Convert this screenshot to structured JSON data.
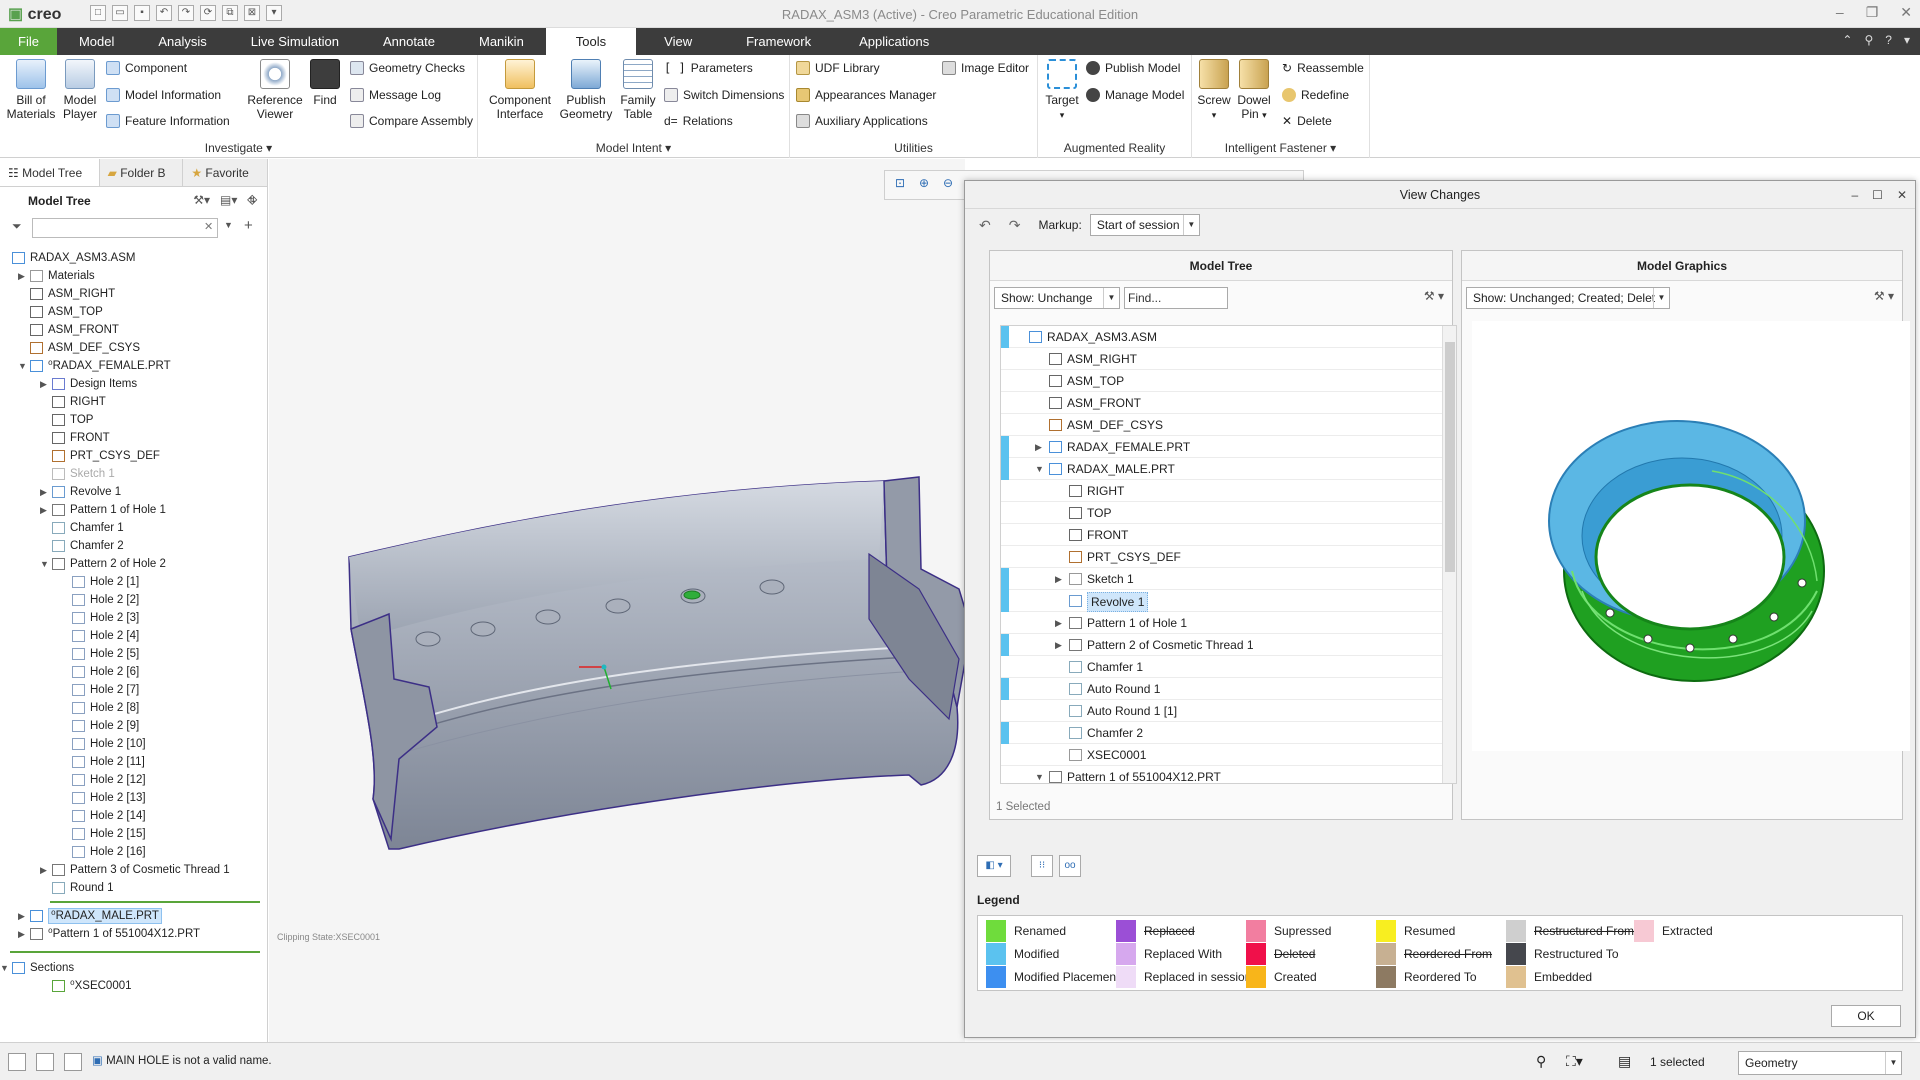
{
  "app": {
    "logo": "creo",
    "window_title": "RADAX_ASM3 (Active) - Creo Parametric Educational Edition"
  },
  "ribbon_tabs": [
    "File",
    "Model",
    "Analysis",
    "Live Simulation",
    "Annotate",
    "Manikin",
    "Tools",
    "View",
    "Framework",
    "Applications"
  ],
  "ribbon": {
    "investigate": {
      "label": "Investigate",
      "bill_of_materials": "Bill of Materials",
      "model_player": "Model Player",
      "component": "Component",
      "model_information": "Model Information",
      "feature_information": "Feature Information",
      "reference_viewer": "Reference Viewer",
      "find": "Find",
      "geometry_checks": "Geometry Checks",
      "message_log": "Message Log",
      "compare_assembly": "Compare Assembly"
    },
    "model_intent": {
      "label": "Model Intent",
      "component_interface": "Component Interface",
      "publish_geometry": "Publish Geometry",
      "family_table": "Family Table",
      "parameters": "Parameters",
      "switch_dimensions": "Switch Dimensions",
      "relations": "Relations"
    },
    "utilities": {
      "label": "Utilities",
      "udf_library": "UDF Library",
      "appearances_manager": "Appearances Manager",
      "auxiliary_applications": "Auxiliary Applications",
      "image_editor": "Image Editor"
    },
    "augmented_reality": {
      "label": "Augmented Reality",
      "target": "Target",
      "publish_model": "Publish Model",
      "manage_model": "Manage Model"
    },
    "intelligent_fastener": {
      "label": "Intelligent Fastener",
      "screw": "Screw",
      "dowel_pin": "Dowel Pin",
      "reassemble": "Reassemble",
      "redefine": "Redefine",
      "delete": "Delete"
    }
  },
  "left_panel": {
    "tabs": [
      "Model Tree",
      "Folder B",
      "Favorite"
    ],
    "header": "Model Tree",
    "tree": [
      {
        "label": "RADAX_ASM3.ASM",
        "level": 0,
        "exp": "",
        "icon": "#4a90d9"
      },
      {
        "label": "Materials",
        "level": 1,
        "exp": "▶",
        "icon": "#999"
      },
      {
        "label": "ASM_RIGHT",
        "level": 1,
        "exp": "",
        "icon": "#666"
      },
      {
        "label": "ASM_TOP",
        "level": 1,
        "exp": "",
        "icon": "#666"
      },
      {
        "label": "ASM_FRONT",
        "level": 1,
        "exp": "",
        "icon": "#666"
      },
      {
        "label": "ASM_DEF_CSYS",
        "level": 1,
        "exp": "",
        "icon": "#b07030"
      },
      {
        "label": "⁰RADAX_FEMALE.PRT",
        "level": 1,
        "exp": "▼",
        "icon": "#4a90d9"
      },
      {
        "label": "Design Items",
        "level": 2,
        "exp": "▶",
        "icon": "#6a7bd0"
      },
      {
        "label": "RIGHT",
        "level": 2,
        "exp": "",
        "icon": "#666"
      },
      {
        "label": "TOP",
        "level": 2,
        "exp": "",
        "icon": "#666"
      },
      {
        "label": "FRONT",
        "level": 2,
        "exp": "",
        "icon": "#666"
      },
      {
        "label": "PRT_CSYS_DEF",
        "level": 2,
        "exp": "",
        "icon": "#b07030"
      },
      {
        "label": "Sketch 1",
        "level": 2,
        "exp": "",
        "icon": "#bbb",
        "dim": true
      },
      {
        "label": "Revolve 1",
        "level": 2,
        "exp": "▶",
        "icon": "#6a9bd0"
      },
      {
        "label": "Pattern 1 of Hole 1",
        "level": 2,
        "exp": "▶",
        "icon": "#777"
      },
      {
        "label": "Chamfer 1",
        "level": 2,
        "exp": "",
        "icon": "#8ab"
      },
      {
        "label": "Chamfer 2",
        "level": 2,
        "exp": "",
        "icon": "#8ab"
      },
      {
        "label": "Pattern 2 of Hole 2",
        "level": 2,
        "exp": "▼",
        "icon": "#777"
      },
      {
        "label": "Hole 2 [1]",
        "level": 3,
        "exp": "",
        "icon": "#8aa0c0"
      },
      {
        "label": "Hole 2 [2]",
        "level": 3,
        "exp": "",
        "icon": "#8aa0c0"
      },
      {
        "label": "Hole 2 [3]",
        "level": 3,
        "exp": "",
        "icon": "#8aa0c0"
      },
      {
        "label": "Hole 2 [4]",
        "level": 3,
        "exp": "",
        "icon": "#8aa0c0"
      },
      {
        "label": "Hole 2 [5]",
        "level": 3,
        "exp": "",
        "icon": "#8aa0c0"
      },
      {
        "label": "Hole 2 [6]",
        "level": 3,
        "exp": "",
        "icon": "#8aa0c0"
      },
      {
        "label": "Hole 2 [7]",
        "level": 3,
        "exp": "",
        "icon": "#8aa0c0"
      },
      {
        "label": "Hole 2 [8]",
        "level": 3,
        "exp": "",
        "icon": "#8aa0c0"
      },
      {
        "label": "Hole 2 [9]",
        "level": 3,
        "exp": "",
        "icon": "#8aa0c0"
      },
      {
        "label": "Hole 2 [10]",
        "level": 3,
        "exp": "",
        "icon": "#8aa0c0"
      },
      {
        "label": "Hole 2 [11]",
        "level": 3,
        "exp": "",
        "icon": "#8aa0c0"
      },
      {
        "label": "Hole 2 [12]",
        "level": 3,
        "exp": "",
        "icon": "#8aa0c0"
      },
      {
        "label": "Hole 2 [13]",
        "level": 3,
        "exp": "",
        "icon": "#8aa0c0"
      },
      {
        "label": "Hole 2 [14]",
        "level": 3,
        "exp": "",
        "icon": "#8aa0c0"
      },
      {
        "label": "Hole 2 [15]",
        "level": 3,
        "exp": "",
        "icon": "#8aa0c0"
      },
      {
        "label": "Hole 2 [16]",
        "level": 3,
        "exp": "",
        "icon": "#8aa0c0"
      },
      {
        "label": "Pattern 3 of Cosmetic Thread 1",
        "level": 2,
        "exp": "▶",
        "icon": "#777"
      },
      {
        "label": "Round 1",
        "level": 2,
        "exp": "",
        "icon": "#8ab"
      }
    ],
    "tree2": [
      {
        "label": "⁰RADAX_MALE.PRT",
        "exp": "▶",
        "icon": "#4a90d9",
        "sel": true
      },
      {
        "label": "⁰Pattern 1 of 551004X12.PRT",
        "exp": "▶",
        "icon": "#777"
      }
    ],
    "sections": [
      {
        "label": "Sections",
        "exp": "▼",
        "icon": "#4a90d9",
        "level": 0
      },
      {
        "label": "⁰XSEC0001",
        "exp": "",
        "icon": "#59a53a",
        "level": 2
      }
    ]
  },
  "graphics": {
    "clipping_state": "Clipping State:XSEC0001"
  },
  "dialog": {
    "title": "View Changes",
    "markup_label": "Markup:",
    "markup_value": "Start of session",
    "tree_pane": {
      "title": "Model Tree",
      "show_value": "Show: Unchange",
      "find_placeholder": "Find...",
      "rows": [
        {
          "label": "RADAX_ASM3.ASM",
          "level": 0,
          "exp": "",
          "mark": "#5bc2ef",
          "icon": "#4a90d9"
        },
        {
          "label": "ASM_RIGHT",
          "level": 1,
          "exp": "",
          "mark": "",
          "icon": "#666"
        },
        {
          "label": "ASM_TOP",
          "level": 1,
          "exp": "",
          "mark": "",
          "icon": "#666"
        },
        {
          "label": "ASM_FRONT",
          "level": 1,
          "exp": "",
          "mark": "",
          "icon": "#666"
        },
        {
          "label": "ASM_DEF_CSYS",
          "level": 1,
          "exp": "",
          "mark": "",
          "icon": "#b07030"
        },
        {
          "label": "RADAX_FEMALE.PRT",
          "level": 1,
          "exp": "▶",
          "mark": "#5bc2ef",
          "icon": "#4a90d9"
        },
        {
          "label": "RADAX_MALE.PRT",
          "level": 1,
          "exp": "▼",
          "mark": "#5bc2ef",
          "icon": "#4a90d9"
        },
        {
          "label": "RIGHT",
          "level": 2,
          "exp": "",
          "mark": "",
          "icon": "#666"
        },
        {
          "label": "TOP",
          "level": 2,
          "exp": "",
          "mark": "",
          "icon": "#666"
        },
        {
          "label": "FRONT",
          "level": 2,
          "exp": "",
          "mark": "",
          "icon": "#666"
        },
        {
          "label": "PRT_CSYS_DEF",
          "level": 2,
          "exp": "",
          "mark": "",
          "icon": "#b07030"
        },
        {
          "label": "Sketch 1",
          "level": 2,
          "exp": "▶",
          "mark": "#5bc2ef",
          "icon": "#999"
        },
        {
          "label": "Revolve 1",
          "level": 2,
          "exp": "",
          "mark": "#5bc2ef",
          "icon": "#6a9bd0",
          "sel": true
        },
        {
          "label": "Pattern 1 of Hole 1",
          "level": 2,
          "exp": "▶",
          "mark": "",
          "icon": "#777"
        },
        {
          "label": "Pattern 2 of Cosmetic Thread 1",
          "level": 2,
          "exp": "▶",
          "mark": "#5bc2ef",
          "icon": "#777"
        },
        {
          "label": "Chamfer 1",
          "level": 2,
          "exp": "",
          "mark": "",
          "icon": "#8ab"
        },
        {
          "label": "Auto Round 1",
          "level": 2,
          "exp": "",
          "mark": "#5bc2ef",
          "icon": "#8ab"
        },
        {
          "label": "Auto Round 1 [1]",
          "level": 2,
          "exp": "",
          "mark": "",
          "icon": "#8ab"
        },
        {
          "label": "Chamfer 2",
          "level": 2,
          "exp": "",
          "mark": "#5bc2ef",
          "icon": "#8ab"
        },
        {
          "label": "XSEC0001",
          "level": 2,
          "exp": "",
          "mark": "",
          "icon": "#999"
        },
        {
          "label": "Pattern 1 of 551004X12.PRT",
          "level": 1,
          "exp": "▼",
          "mark": "",
          "icon": "#777"
        }
      ],
      "selected_count": "1 Selected"
    },
    "graphics_pane": {
      "title": "Model Graphics",
      "show_value": "Show: Unchanged; Created; Delet"
    },
    "legend_label": "Legend",
    "legend": [
      {
        "label": "Renamed",
        "color": "#6fdc3c",
        "strike": false
      },
      {
        "label": "Modified",
        "color": "#5bc2ef",
        "strike": false
      },
      {
        "label": "Modified Placement",
        "color": "#3d8ff0",
        "strike": false
      },
      {
        "label": "Replaced",
        "color": "#9b4fd6",
        "strike": true
      },
      {
        "label": "Replaced With",
        "color": "#d6a8ee",
        "strike": false
      },
      {
        "label": "Replaced in session",
        "color": "#efdcf7",
        "strike": false
      },
      {
        "label": "Supressed",
        "color": "#f27ea0",
        "strike": false
      },
      {
        "label": "Deleted",
        "color": "#f0104a",
        "strike": true
      },
      {
        "label": "Created",
        "color": "#f8b51a",
        "strike": false
      },
      {
        "label": "Resumed",
        "color": "#f8ee20",
        "strike": false
      },
      {
        "label": "Reordered From",
        "color": "#c7b092",
        "strike": true
      },
      {
        "label": "Reordered To",
        "color": "#8d7a62",
        "strike": false
      },
      {
        "label": "Restructured From",
        "color": "#cfcfcf",
        "strike": true
      },
      {
        "label": "Restructured To",
        "color": "#45474d",
        "strike": false
      },
      {
        "label": "Embedded",
        "color": "#e0c190",
        "strike": false
      },
      {
        "label": "Extracted",
        "color": "#f7c9d4",
        "strike": false
      }
    ],
    "ok_label": "OK"
  },
  "status": {
    "message": "MAIN HOLE is not a valid name.",
    "selected": "1 selected",
    "filter_value": "Geometry"
  }
}
